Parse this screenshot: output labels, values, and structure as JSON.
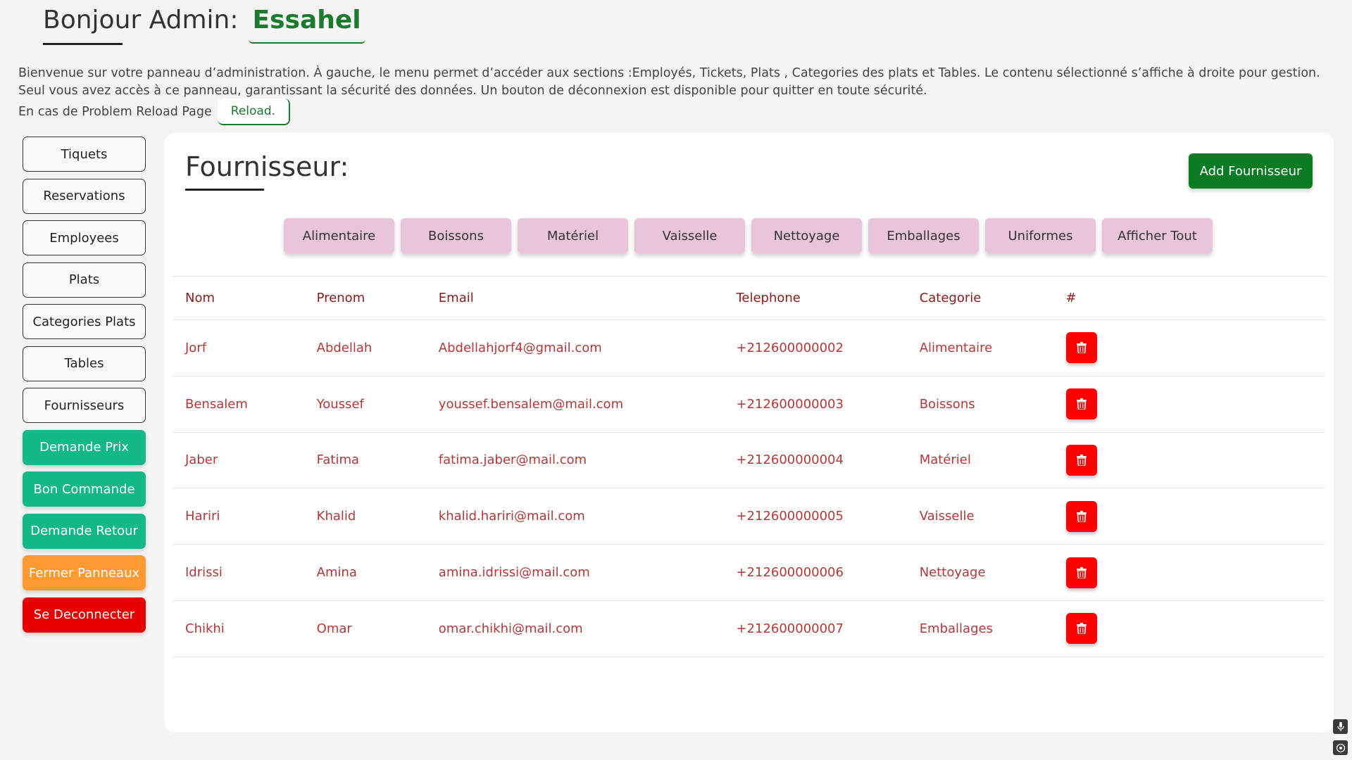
{
  "header": {
    "greeting": "Bonjour Admin:",
    "admin_name": "Essahel"
  },
  "intro": {
    "line1": "Bienvenue sur votre panneau d’administration. À gauche, le menu permet d’accéder aux sections :Employés, Tickets, Plats , Categories des plats et Tables. Le contenu sélectionné s’affiche à droite pour gestion.",
    "line2": "Seul vous avez accès à ce panneau, garantissant la sécurité des données. Un bouton de déconnexion est disponible pour quitter en toute sécurité.",
    "reload_text": "En cas de Problem Reload Page",
    "reload_label": "Reload."
  },
  "sidebar": {
    "items": [
      {
        "label": "Tiquets",
        "style": "outline"
      },
      {
        "label": "Reservations",
        "style": "outline"
      },
      {
        "label": "Employees",
        "style": "outline"
      },
      {
        "label": "Plats",
        "style": "outline"
      },
      {
        "label": "Categories Plats",
        "style": "outline"
      },
      {
        "label": "Tables",
        "style": "outline"
      },
      {
        "label": "Fournisseurs",
        "style": "outline"
      },
      {
        "label": "Demande Prix",
        "style": "green"
      },
      {
        "label": "Bon Commande",
        "style": "green"
      },
      {
        "label": "Demande Retour",
        "style": "green"
      },
      {
        "label": "Fermer Panneaux",
        "style": "orange"
      },
      {
        "label": "Se Deconnecter",
        "style": "red"
      }
    ]
  },
  "panel": {
    "title": "Fournisseur:",
    "add_label": "Add Fournisseur",
    "filters": [
      "Alimentaire",
      "Boissons",
      "Matériel",
      "Vaisselle",
      "Nettoyage",
      "Emballages",
      "Uniformes",
      "Afficher Tout"
    ]
  },
  "table": {
    "headers": [
      "Nom",
      "Prenom",
      "Email",
      "Telephone",
      "Categorie",
      "#"
    ],
    "rows": [
      [
        "Jorf",
        "Abdellah",
        "Abdellahjorf4@gmail.com",
        "+212600000002",
        "Alimentaire"
      ],
      [
        "Bensalem",
        "Youssef",
        "youssef.bensalem@mail.com",
        "+212600000003",
        "Boissons"
      ],
      [
        "Jaber",
        "Fatima",
        "fatima.jaber@mail.com",
        "+212600000004",
        "Matériel"
      ],
      [
        "Hariri",
        "Khalid",
        "khalid.hariri@mail.com",
        "+212600000005",
        "Vaisselle"
      ],
      [
        "Idrissi",
        "Amina",
        "amina.idrissi@mail.com",
        "+212600000006",
        "Nettoyage"
      ],
      [
        "Chikhi",
        "Omar",
        "omar.chikhi@mail.com",
        "+212600000007",
        "Emballages"
      ]
    ]
  },
  "colors": {
    "accent_green": "#0a7a25",
    "teal": "#12b886",
    "orange": "#fd9a32",
    "danger_red": "#ff0000",
    "filter_pink": "#e8c5d8",
    "text_maroon": "#8b1c1c"
  },
  "icons": {
    "delete": "trash-icon",
    "mic": "microphone-icon",
    "assist": "assist-icon"
  }
}
